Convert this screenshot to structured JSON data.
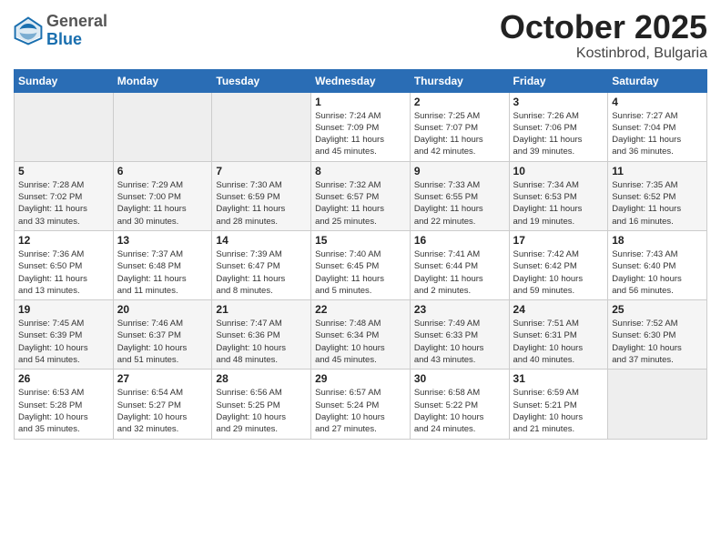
{
  "header": {
    "logo": {
      "general": "General",
      "blue": "Blue"
    },
    "title": "October 2025",
    "location": "Kostinbrod, Bulgaria"
  },
  "calendar": {
    "days_of_week": [
      "Sunday",
      "Monday",
      "Tuesday",
      "Wednesday",
      "Thursday",
      "Friday",
      "Saturday"
    ],
    "weeks": [
      [
        {
          "day": "",
          "info": ""
        },
        {
          "day": "",
          "info": ""
        },
        {
          "day": "",
          "info": ""
        },
        {
          "day": "1",
          "info": "Sunrise: 7:24 AM\nSunset: 7:09 PM\nDaylight: 11 hours\nand 45 minutes."
        },
        {
          "day": "2",
          "info": "Sunrise: 7:25 AM\nSunset: 7:07 PM\nDaylight: 11 hours\nand 42 minutes."
        },
        {
          "day": "3",
          "info": "Sunrise: 7:26 AM\nSunset: 7:06 PM\nDaylight: 11 hours\nand 39 minutes."
        },
        {
          "day": "4",
          "info": "Sunrise: 7:27 AM\nSunset: 7:04 PM\nDaylight: 11 hours\nand 36 minutes."
        }
      ],
      [
        {
          "day": "5",
          "info": "Sunrise: 7:28 AM\nSunset: 7:02 PM\nDaylight: 11 hours\nand 33 minutes."
        },
        {
          "day": "6",
          "info": "Sunrise: 7:29 AM\nSunset: 7:00 PM\nDaylight: 11 hours\nand 30 minutes."
        },
        {
          "day": "7",
          "info": "Sunrise: 7:30 AM\nSunset: 6:59 PM\nDaylight: 11 hours\nand 28 minutes."
        },
        {
          "day": "8",
          "info": "Sunrise: 7:32 AM\nSunset: 6:57 PM\nDaylight: 11 hours\nand 25 minutes."
        },
        {
          "day": "9",
          "info": "Sunrise: 7:33 AM\nSunset: 6:55 PM\nDaylight: 11 hours\nand 22 minutes."
        },
        {
          "day": "10",
          "info": "Sunrise: 7:34 AM\nSunset: 6:53 PM\nDaylight: 11 hours\nand 19 minutes."
        },
        {
          "day": "11",
          "info": "Sunrise: 7:35 AM\nSunset: 6:52 PM\nDaylight: 11 hours\nand 16 minutes."
        }
      ],
      [
        {
          "day": "12",
          "info": "Sunrise: 7:36 AM\nSunset: 6:50 PM\nDaylight: 11 hours\nand 13 minutes."
        },
        {
          "day": "13",
          "info": "Sunrise: 7:37 AM\nSunset: 6:48 PM\nDaylight: 11 hours\nand 11 minutes."
        },
        {
          "day": "14",
          "info": "Sunrise: 7:39 AM\nSunset: 6:47 PM\nDaylight: 11 hours\nand 8 minutes."
        },
        {
          "day": "15",
          "info": "Sunrise: 7:40 AM\nSunset: 6:45 PM\nDaylight: 11 hours\nand 5 minutes."
        },
        {
          "day": "16",
          "info": "Sunrise: 7:41 AM\nSunset: 6:44 PM\nDaylight: 11 hours\nand 2 minutes."
        },
        {
          "day": "17",
          "info": "Sunrise: 7:42 AM\nSunset: 6:42 PM\nDaylight: 10 hours\nand 59 minutes."
        },
        {
          "day": "18",
          "info": "Sunrise: 7:43 AM\nSunset: 6:40 PM\nDaylight: 10 hours\nand 56 minutes."
        }
      ],
      [
        {
          "day": "19",
          "info": "Sunrise: 7:45 AM\nSunset: 6:39 PM\nDaylight: 10 hours\nand 54 minutes."
        },
        {
          "day": "20",
          "info": "Sunrise: 7:46 AM\nSunset: 6:37 PM\nDaylight: 10 hours\nand 51 minutes."
        },
        {
          "day": "21",
          "info": "Sunrise: 7:47 AM\nSunset: 6:36 PM\nDaylight: 10 hours\nand 48 minutes."
        },
        {
          "day": "22",
          "info": "Sunrise: 7:48 AM\nSunset: 6:34 PM\nDaylight: 10 hours\nand 45 minutes."
        },
        {
          "day": "23",
          "info": "Sunrise: 7:49 AM\nSunset: 6:33 PM\nDaylight: 10 hours\nand 43 minutes."
        },
        {
          "day": "24",
          "info": "Sunrise: 7:51 AM\nSunset: 6:31 PM\nDaylight: 10 hours\nand 40 minutes."
        },
        {
          "day": "25",
          "info": "Sunrise: 7:52 AM\nSunset: 6:30 PM\nDaylight: 10 hours\nand 37 minutes."
        }
      ],
      [
        {
          "day": "26",
          "info": "Sunrise: 6:53 AM\nSunset: 5:28 PM\nDaylight: 10 hours\nand 35 minutes."
        },
        {
          "day": "27",
          "info": "Sunrise: 6:54 AM\nSunset: 5:27 PM\nDaylight: 10 hours\nand 32 minutes."
        },
        {
          "day": "28",
          "info": "Sunrise: 6:56 AM\nSunset: 5:25 PM\nDaylight: 10 hours\nand 29 minutes."
        },
        {
          "day": "29",
          "info": "Sunrise: 6:57 AM\nSunset: 5:24 PM\nDaylight: 10 hours\nand 27 minutes."
        },
        {
          "day": "30",
          "info": "Sunrise: 6:58 AM\nSunset: 5:22 PM\nDaylight: 10 hours\nand 24 minutes."
        },
        {
          "day": "31",
          "info": "Sunrise: 6:59 AM\nSunset: 5:21 PM\nDaylight: 10 hours\nand 21 minutes."
        },
        {
          "day": "",
          "info": ""
        }
      ]
    ]
  }
}
